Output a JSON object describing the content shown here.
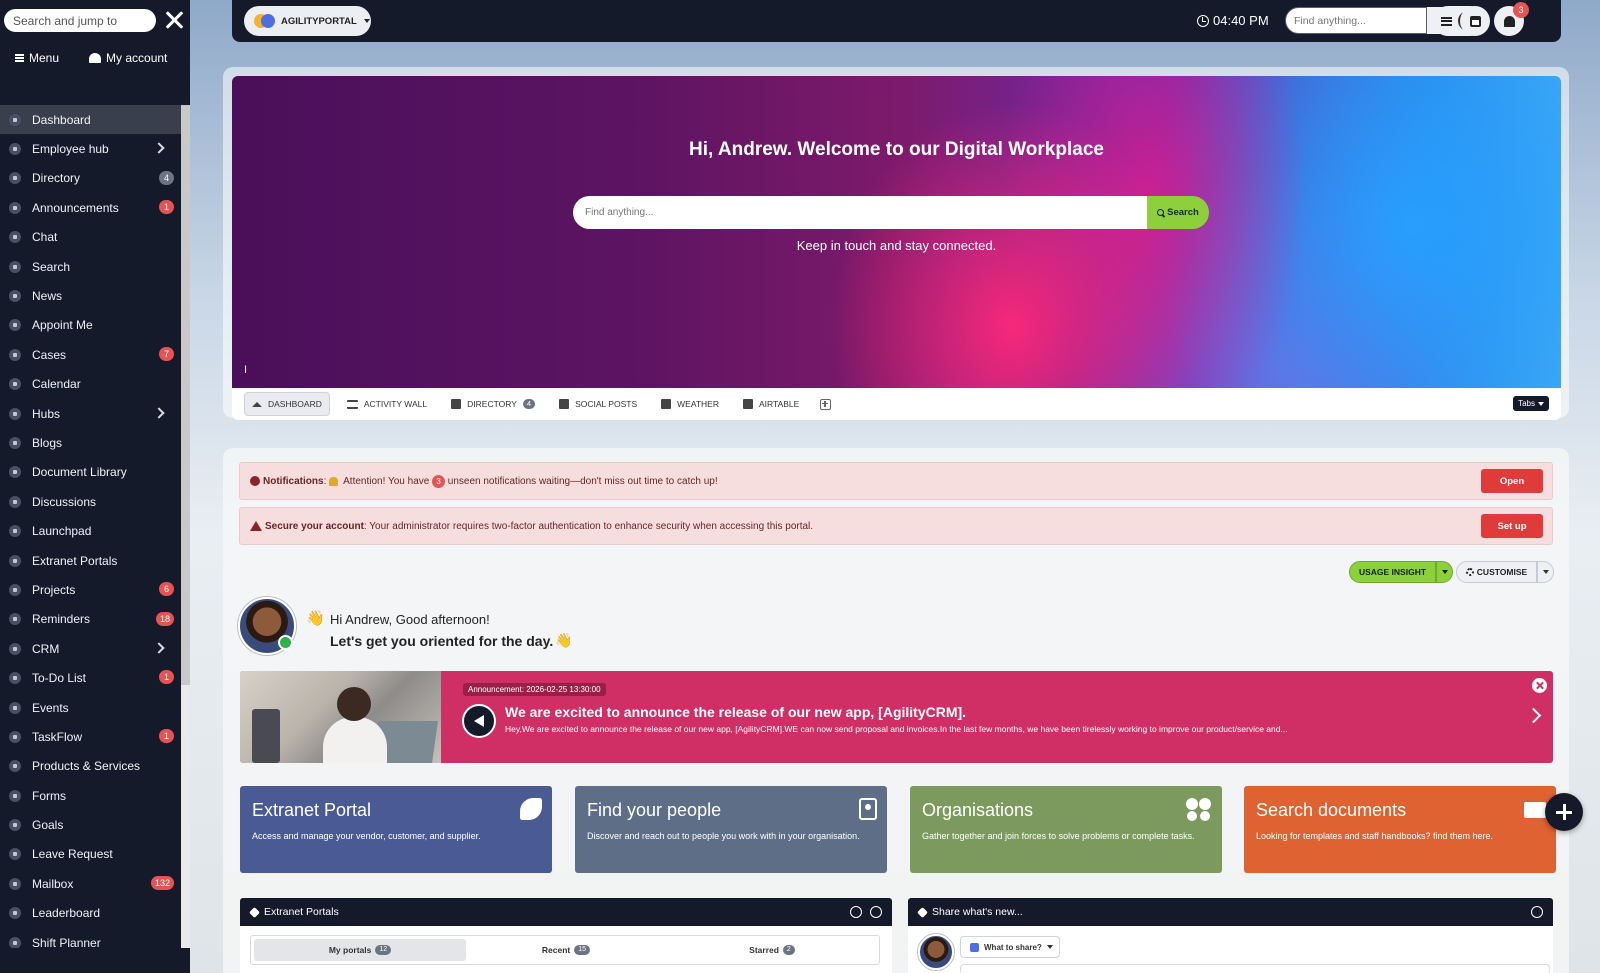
{
  "sidebar": {
    "search_placeholder": "Search and jump to",
    "menu_label": "Menu",
    "account_label": "My account",
    "items": [
      {
        "label": "Dashboard",
        "badge": "",
        "chevron": false,
        "active": true
      },
      {
        "label": "Employee hub",
        "badge": "",
        "chevron": true
      },
      {
        "label": "Directory",
        "badge": "4",
        "badge_color": "gray"
      },
      {
        "label": "Announcements",
        "badge": "1",
        "badge_color": "red"
      },
      {
        "label": "Chat",
        "badge": ""
      },
      {
        "label": "Search",
        "badge": ""
      },
      {
        "label": "News",
        "badge": ""
      },
      {
        "label": "Appoint Me",
        "badge": ""
      },
      {
        "label": "Cases",
        "badge": "7",
        "badge_color": "red"
      },
      {
        "label": "Calendar",
        "badge": ""
      },
      {
        "label": "Hubs",
        "badge": "",
        "chevron": true
      },
      {
        "label": "Blogs",
        "badge": ""
      },
      {
        "label": "Document Library",
        "badge": ""
      },
      {
        "label": "Discussions",
        "badge": ""
      },
      {
        "label": "Launchpad",
        "badge": ""
      },
      {
        "label": "Extranet Portals",
        "badge": ""
      },
      {
        "label": "Projects",
        "badge": "6",
        "badge_color": "red"
      },
      {
        "label": "Reminders",
        "badge": "18",
        "badge_color": "red"
      },
      {
        "label": "CRM",
        "badge": "",
        "chevron": true
      },
      {
        "label": "To-Do List",
        "badge": "1",
        "badge_color": "red"
      },
      {
        "label": "Events",
        "badge": ""
      },
      {
        "label": "TaskFlow",
        "badge": "1",
        "badge_color": "red"
      },
      {
        "label": "Products & Services",
        "badge": ""
      },
      {
        "label": "Forms",
        "badge": ""
      },
      {
        "label": "Goals",
        "badge": ""
      },
      {
        "label": "Leave Request",
        "badge": ""
      },
      {
        "label": "Mailbox",
        "badge": "132",
        "badge_color": "red"
      },
      {
        "label": "Leaderboard",
        "badge": ""
      },
      {
        "label": "Shift Planner",
        "badge": ""
      }
    ]
  },
  "topbar": {
    "portal_label": "AGILITYPORTAL",
    "time": "04:40 PM",
    "search_placeholder": "Find anything...",
    "notification_count": "3"
  },
  "hero": {
    "title": "Hi, Andrew. Welcome to our Digital Workplace",
    "search_placeholder": "Find anything...",
    "search_button": "Search",
    "subtitle": "Keep in touch and stay connected."
  },
  "tabs": {
    "items": [
      {
        "label": "DASHBOARD",
        "icon": "home-icon",
        "badge": ""
      },
      {
        "label": "ACTIVITY WALL",
        "icon": "list-icon",
        "badge": ""
      },
      {
        "label": "DIRECTORY",
        "icon": "contact-icon",
        "badge": "4"
      },
      {
        "label": "SOCIAL POSTS",
        "icon": "square-icon",
        "badge": ""
      },
      {
        "label": "WEATHER",
        "icon": "square-icon",
        "badge": ""
      },
      {
        "label": "AIRTABLE",
        "icon": "square-icon",
        "badge": ""
      }
    ],
    "dropdown_label": "Tabs"
  },
  "alerts": {
    "notification": {
      "label": "Notifications",
      "text_before": "Attention! You have",
      "count": "3",
      "text_after": "unseen notifications waiting—don't miss out time to catch up!",
      "button": "Open"
    },
    "security": {
      "label": "Secure your account",
      "text": ": Your administrator requires two-factor authentication to enhance security when accessing this portal.",
      "button": "Set up"
    }
  },
  "actions": {
    "usage_label": "USAGE INSIGHT",
    "customise_label": "CUSTOMISE"
  },
  "greeting": {
    "line1": "Hi Andrew, Good afternoon!",
    "line2": "Let's get you oriented for the day."
  },
  "announcement": {
    "tag": "Announcement: 2026-02-25 13:30:00",
    "title": "We are excited to announce the release of our new app, [AgilityCRM].",
    "text": "Hey,We are excited to announce the release of our new app, [AgilityCRM].WE can now send proposal and invoices.In the last few months, we have been tirelessly working to improve our product/service and..."
  },
  "tiles": [
    {
      "title": "Extranet Portal",
      "desc": "Access and manage your vendor, customer, and supplier.",
      "color": "#4a5a94",
      "icon": "rocket-icon"
    },
    {
      "title": "Find your people",
      "desc": "Discover and reach out to people you work with in your organisation.",
      "color": "#5e6e86",
      "icon": "contact-book-icon"
    },
    {
      "title": "Organisations",
      "desc": "Gather together and join forces to solve problems or complete tasks.",
      "color": "#7d9a5e",
      "icon": "users-icon"
    },
    {
      "title": "Search documents",
      "desc": "Looking for templates and staff handbooks? find them here.",
      "color": "#df6232",
      "icon": "folder-plus-icon"
    }
  ],
  "panels": {
    "extranet": {
      "title": "Extranet Portals",
      "tabs": [
        {
          "label": "My portals",
          "count": "12"
        },
        {
          "label": "Recent",
          "count": "15"
        },
        {
          "label": "Starred",
          "count": "2"
        }
      ]
    },
    "share": {
      "title": "Share what's new...",
      "dropdown": "What to share?"
    }
  }
}
